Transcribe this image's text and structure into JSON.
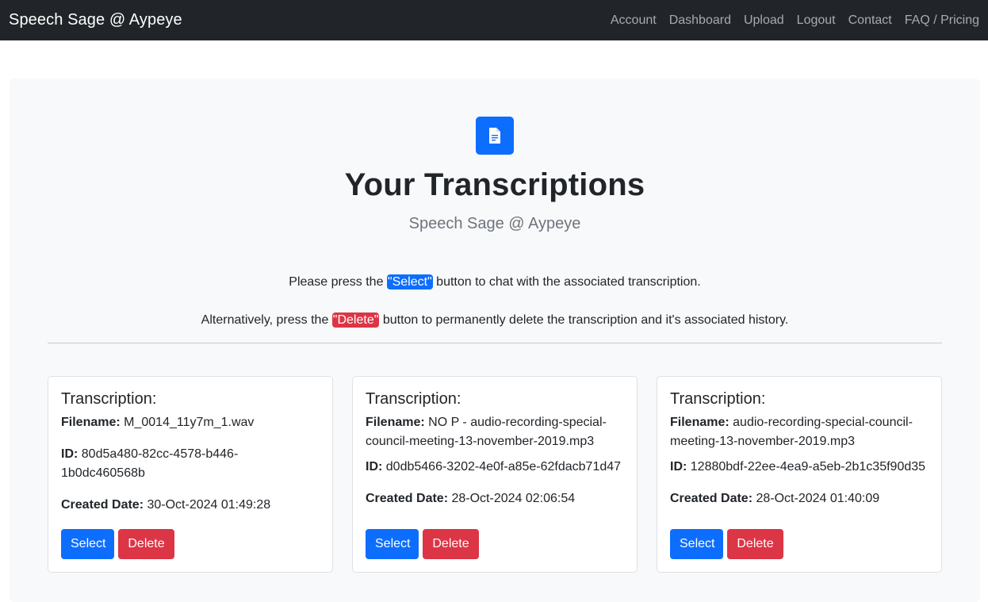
{
  "navbar": {
    "brand": "Speech Sage @ Aypeye",
    "links": [
      "Account",
      "Dashboard",
      "Upload",
      "Logout",
      "Contact",
      "FAQ / Pricing"
    ]
  },
  "header": {
    "icon": "document-icon",
    "title": "Your Transcriptions",
    "subtitle": "Speech Sage @ Aypeye"
  },
  "instructions": {
    "line1_before": "Please press the ",
    "line1_highlight": "\"Select\"",
    "line1_after": " button to chat with the associated transcription.",
    "line2_before": "Alternatively, press the ",
    "line2_highlight": "\"Delete\"",
    "line2_after": " button to permanently delete the transcription and it's associated history."
  },
  "labels": {
    "card_title": "Transcription:",
    "filename": "Filename:",
    "id": "ID:",
    "created": "Created Date:",
    "select": "Select",
    "delete": "Delete"
  },
  "transcriptions": [
    {
      "filename": "M_0014_11y7m_1.wav",
      "id": "80d5a480-82cc-4578-b446-1b0dc460568b",
      "created": "30-Oct-2024 01:49:28"
    },
    {
      "filename": "NO P - audio-recording-special-council-meeting-13-november-2019.mp3",
      "id": "d0db5466-3202-4e0f-a85e-62fdacb71d47",
      "created": "28-Oct-2024 02:06:54"
    },
    {
      "filename": "audio-recording-special-council-meeting-13-november-2019.mp3",
      "id": "12880bdf-22ee-4ea9-a5eb-2b1c35f90d35",
      "created": "28-Oct-2024 01:40:09"
    }
  ],
  "colors": {
    "navbar": "#212529",
    "primary": "#0d6efd",
    "danger": "#dc3545",
    "panel": "#f8f9fa"
  }
}
